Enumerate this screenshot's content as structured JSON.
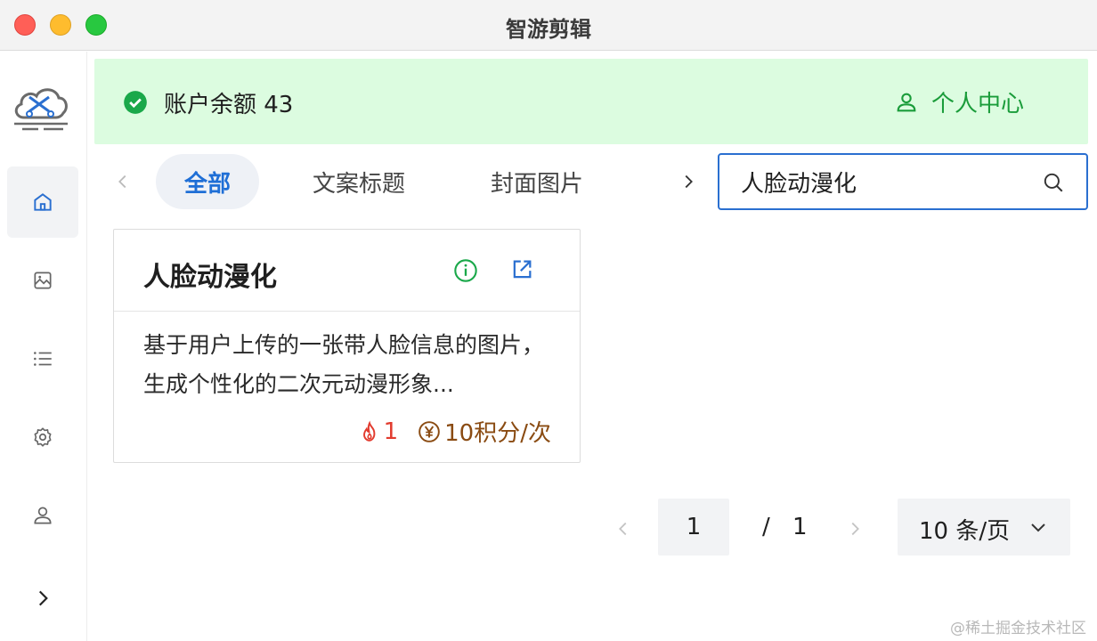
{
  "window": {
    "title": "智游剪辑"
  },
  "sidebar": {
    "items": [
      {
        "name": "home",
        "active": true
      },
      {
        "name": "image",
        "active": false
      },
      {
        "name": "list",
        "active": false
      },
      {
        "name": "settings",
        "active": false
      },
      {
        "name": "user",
        "active": false
      }
    ],
    "expand_icon": "chevron-right-icon"
  },
  "banner": {
    "balance_label": "账户余额 43",
    "personal_center": "个人中心",
    "bg_color": "#dcfce0",
    "accent_color": "#1a9c3a"
  },
  "tabs": {
    "items": [
      {
        "label": "全部",
        "active": true
      },
      {
        "label": "文案标题",
        "active": false
      },
      {
        "label": "封面图片",
        "active": false
      }
    ]
  },
  "search": {
    "value": "人脸动漫化"
  },
  "cards": [
    {
      "title": "人脸动漫化",
      "description": "基于用户上传的一张带人脸信息的图片，生成个性化的二次元动漫形象...",
      "hot_count": "1",
      "cost": "10积分/次"
    }
  ],
  "pagination": {
    "current_page": "1",
    "separator": "/",
    "total_pages": "1",
    "page_size_label": "10 条/页"
  },
  "watermark": "@稀土掘金技术社区"
}
